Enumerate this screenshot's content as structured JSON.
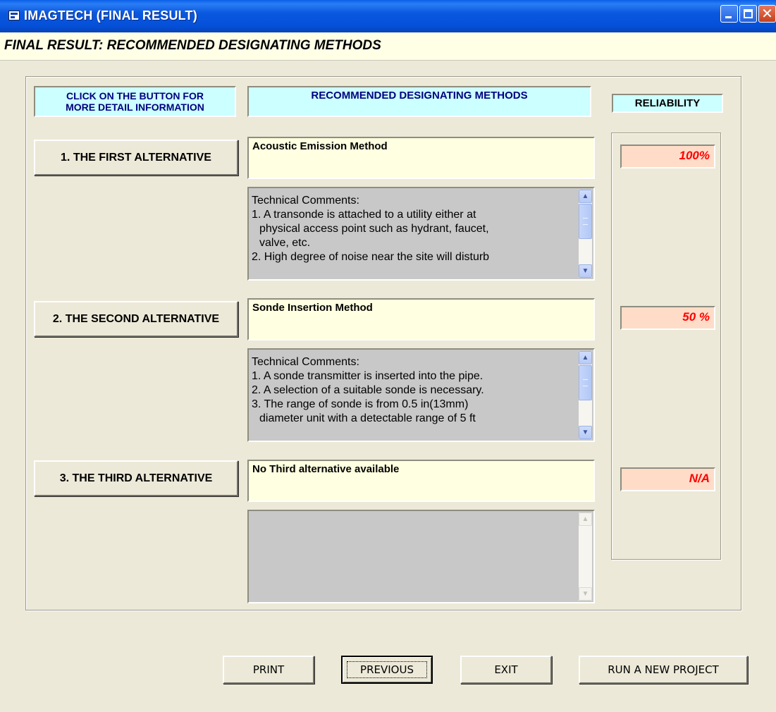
{
  "window": {
    "title": "IMAGTECH (FINAL RESULT)",
    "header": "FINAL RESULT: RECOMMENDED DESIGNATING METHODS"
  },
  "headers": {
    "click_line1": "CLICK ON THE BUTTON  FOR",
    "click_line2": "MORE DETAIL INFORMATION",
    "methods": "RECOMMENDED DESIGNATING METHODS",
    "reliability": "RELIABILITY"
  },
  "alternatives": [
    {
      "button": "1. THE FIRST ALTERNATIVE",
      "method": "Acoustic Emission Method",
      "reliability": "100%",
      "comments": {
        "l0": "Technical Comments:",
        "l1": "1. A transonde is attached to a utility either at",
        "l2": "physical access point such as hydrant, faucet,",
        "l3": "valve, etc.",
        "l4": "2. High degree of noise near the site will disturb"
      }
    },
    {
      "button": "2. THE SECOND ALTERNATIVE",
      "method": "Sonde Insertion Method",
      "reliability": "50 %",
      "comments": {
        "l0": "Technical Comments:",
        "l1": "1. A sonde transmitter is inserted into the pipe.",
        "l2": "2. A selection of a suitable sonde is necessary.",
        "l3": "3. The range of sonde is from 0.5 in(13mm)",
        "l4": "diameter unit with a detectable range of 5 ft"
      }
    },
    {
      "button": "3. THE THIRD ALTERNATIVE",
      "method": "No Third alternative available",
      "reliability": "N/A"
    }
  ],
  "footer": {
    "print": "PRINT",
    "previous": "PREVIOUS",
    "exit": "EXIT",
    "new_project": "RUN A NEW PROJECT"
  },
  "colors": {
    "titlebar": "#0a58df",
    "header_band": "#ffffe6",
    "cyan_header": "#ccffff",
    "method_box": "#ffffe1",
    "reliability_box": "#ffdcc8",
    "reliability_text": "#ff0000"
  }
}
